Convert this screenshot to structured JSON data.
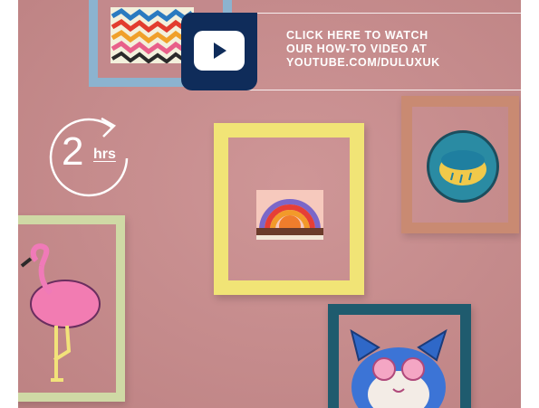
{
  "video_banner": {
    "line1": "CLICK HERE TO WATCH",
    "line2": "OUR HOW-TO VIDEO AT",
    "line3": "YOUTUBE.COM/DULUXUK",
    "icon": "play-icon"
  },
  "timer": {
    "value": "2",
    "unit": "hrs",
    "icon": "clock-arrow-icon"
  },
  "colors": {
    "wall": "#c98a8b",
    "video_tile": "#0f2c5a",
    "frame_yellow": "#f1e476",
    "frame_copper": "#c98a72",
    "frame_teal": "#1f5b6e",
    "frame_green": "#cfd9a5",
    "frame_blue": "#8cb3cf"
  }
}
